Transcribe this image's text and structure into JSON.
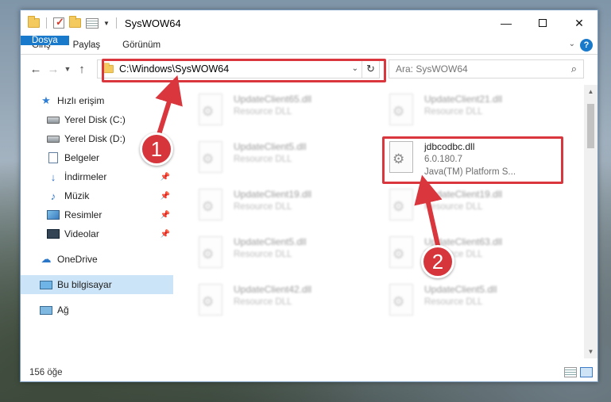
{
  "window": {
    "title": "SysWOW64",
    "controls": {
      "minimize": "—",
      "maximize": "",
      "close": "✕"
    }
  },
  "ribbon": {
    "tabs": [
      {
        "label": "Dosya"
      },
      {
        "label": "Giriş"
      },
      {
        "label": "Paylaş"
      },
      {
        "label": "Görünüm"
      }
    ],
    "help": "?"
  },
  "address": {
    "path": "C:\\Windows\\SysWOW64"
  },
  "search": {
    "placeholder": "Ara: SysWOW64"
  },
  "sidebar": {
    "items": [
      {
        "label": "Hızlı erişim",
        "icon": "star-icon"
      },
      {
        "label": "Yerel Disk (C:)",
        "icon": "drive-icon"
      },
      {
        "label": "Yerel Disk (D:)",
        "icon": "drive-icon"
      },
      {
        "label": "Belgeler",
        "icon": "documents-icon",
        "pinned": true
      },
      {
        "label": "İndirmeler",
        "icon": "download-icon",
        "pinned": true
      },
      {
        "label": "Müzik",
        "icon": "music-icon",
        "pinned": true
      },
      {
        "label": "Resimler",
        "icon": "pictures-icon",
        "pinned": true
      },
      {
        "label": "Videolar",
        "icon": "videos-icon",
        "pinned": true
      },
      {
        "label": "OneDrive",
        "icon": "onedrive-icon"
      },
      {
        "label": "Bu bilgisayar",
        "icon": "computer-icon",
        "selected": true
      },
      {
        "label": "Ağ",
        "icon": "network-icon"
      }
    ]
  },
  "files": {
    "blurred": [
      {
        "name": "UpdateClient65.dll",
        "sub": "Resource DLL"
      },
      {
        "name": "UpdateClient21.dll",
        "sub": "Resource DLL"
      },
      {
        "name": "UpdateClient5.dll",
        "sub": "Resource DLL"
      },
      {
        "name": "UpdateClient19.dll",
        "sub": "Resource DLL"
      },
      {
        "name": "UpdateClient19.dll",
        "sub": "Resource DLL"
      },
      {
        "name": "UpdateClient5.dll",
        "sub": "Resource DLL"
      },
      {
        "name": "UpdateClient63.dll",
        "sub": "Resource DLL"
      },
      {
        "name": "UpdateClient42.dll",
        "sub": "Resource DLL"
      },
      {
        "name": "UpdateClient5.dll",
        "sub": "Resource DLL"
      }
    ],
    "highlighted": {
      "name": "jdbcodbc.dll",
      "version": "6.0.180.7",
      "description": "Java(TM) Platform S..."
    }
  },
  "status": {
    "count": "156 öğe"
  },
  "annotations": {
    "badge1": "1",
    "badge2": "2",
    "color": "#d9373d"
  }
}
